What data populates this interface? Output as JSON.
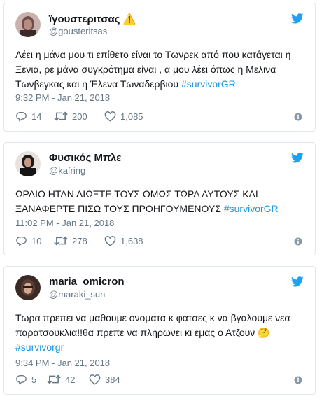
{
  "tweets": [
    {
      "name": "ïγουστεριτσας",
      "warning_emoji": "⚠️",
      "handle": "@gousteritsas",
      "text": "Λέει η μάνα μου τι επίθετο είναι το Τωνρεκ από που κατάγεται η Ξενια, ρε μάνα συγκρότημα είναι , α μου λέει όπως η Μελινα Τωνβεγκας και η Έλενα Τωναδερβιου ",
      "hashtag": "#survivorGR",
      "time": "9:32 PM - Jan 21, 2018",
      "replies": "14",
      "retweets": "200",
      "likes": "1,085",
      "avatar_color": "#8a6a6a"
    },
    {
      "name": "Φυσικός Μπλε",
      "handle": "@kafring",
      "text": "ΩΡΑΙΟ ΗΤΑΝ ΔΙΩΞΤΕ ΤΟΥΣ ΟΜΩΣ ΤΩΡΑ ΑΥΤΟΥΣ ΚΑΙ ΞΑΝΑΦΕΡΤΕ ΠΙΣΩ ΤΟΥΣ ΠΡΟΗΓΟΥΜΕΝΟΥΣ ",
      "hashtag": "#survivorGR",
      "time": "11:02 PM - Jan 21, 2018",
      "replies": "10",
      "retweets": "278",
      "likes": "1,638",
      "avatar_color": "#2a2a2a"
    },
    {
      "name": "maria_omicron",
      "handle": "@maraki_sun",
      "text": "Τωρα πρεπει να μαθουμε ονοματα κ φατσες κ να βγαλουμε νεα παρατσουκλια!!θα πρεπε να πληρωνει κι εμας ο Ατζουν ",
      "emoji": "🤔",
      "hashtag": "#survivorgr",
      "time": "9:34 PM - Jan 21, 2018",
      "replies": "5",
      "retweets": "42",
      "likes": "384",
      "avatar_color": "#5a4038"
    }
  ],
  "colors": {
    "twitter_blue": "#1da1f2",
    "hashtag": "#1b95e0",
    "muted": "#657786",
    "border": "#e1e8ed"
  }
}
